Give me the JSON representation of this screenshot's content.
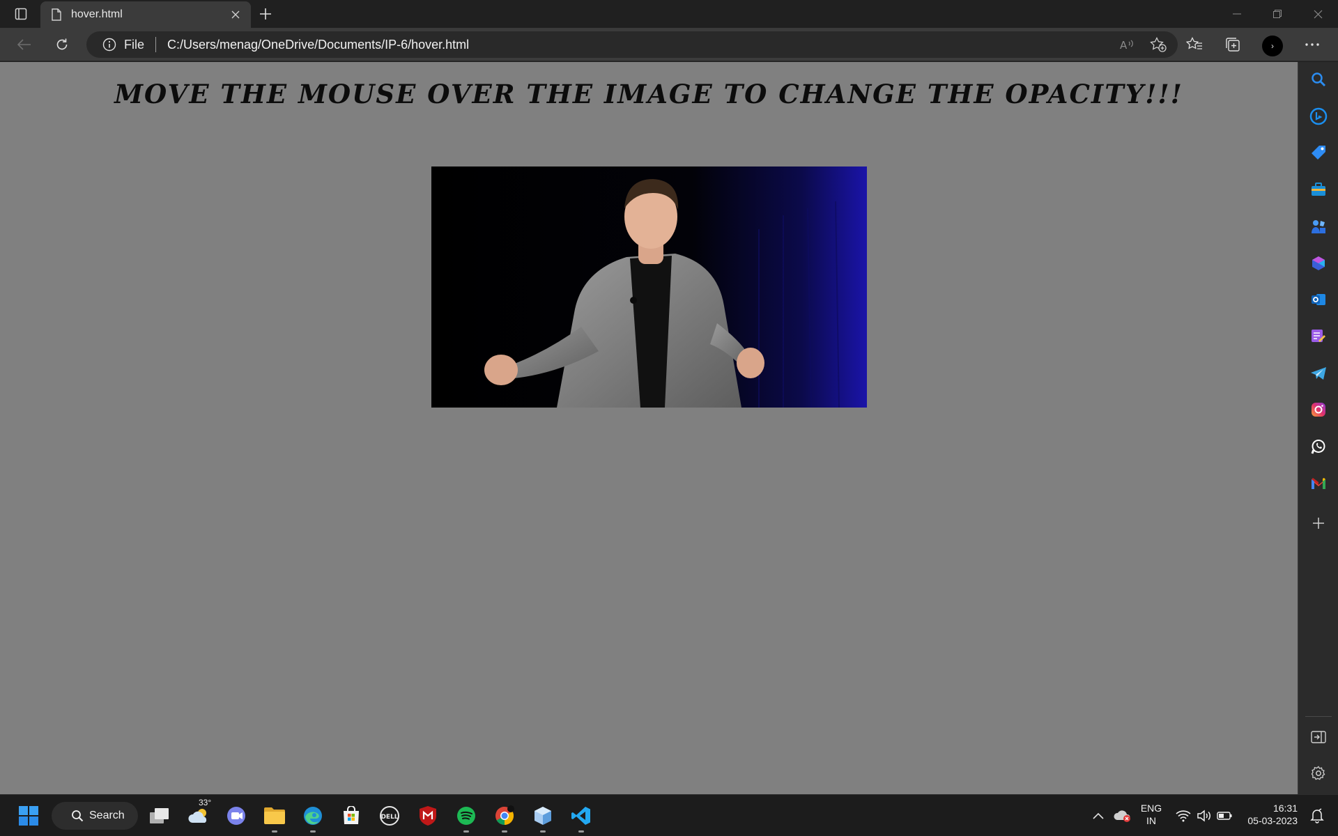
{
  "browser": {
    "tab": {
      "title": "hover.html"
    },
    "address": {
      "scheme_label": "File",
      "url": "C:/Users/menag/OneDrive/Documents/IP-6/hover.html"
    },
    "avatar_glyph": "›"
  },
  "page": {
    "heading": "MOVE THE MOUSE OVER THE IMAGE TO CHANGE THE OPACITY!!!",
    "background": "#808080"
  },
  "sidebar": {
    "items": [
      "search-icon",
      "bing-chat-icon",
      "shopping-tag-icon",
      "tools-briefcase-icon",
      "games-icon",
      "microsoft-365-icon",
      "outlook-icon",
      "designer-icon",
      "telegram-icon",
      "instagram-icon",
      "whatsapp-icon",
      "gmail-icon",
      "add-icon"
    ]
  },
  "taskbar": {
    "search_label": "Search",
    "weather_temp": "33°",
    "language": "ENG",
    "region": "IN",
    "time": "16:31",
    "date": "05-03-2023"
  },
  "colors": {
    "accent_blue": "#0078d4",
    "spotify_green": "#1db954",
    "mcafee_red": "#c01818"
  }
}
